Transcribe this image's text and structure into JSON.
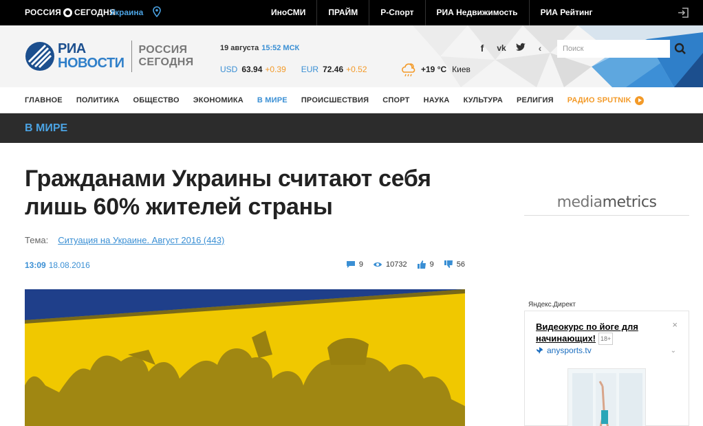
{
  "topbar": {
    "brand_left": "РОССИЯ",
    "brand_right": "СЕГОДНЯ",
    "region": "Украина",
    "links": [
      "ИноСМИ",
      "ПРАЙМ",
      "Р-Спорт",
      "РИА Недвижимость",
      "РИА Рейтинг"
    ]
  },
  "header": {
    "logo_line1": "РИА",
    "logo_line2": "НОВОСТИ",
    "logo_rs1": "РОССИЯ",
    "logo_rs2": "СЕГОДНЯ",
    "date": "19 августа",
    "time": "15:52 МСК",
    "rates": [
      {
        "currency": "USD",
        "value": "63.94",
        "change": "+0.39"
      },
      {
        "currency": "EUR",
        "value": "72.46",
        "change": "+0.52"
      }
    ],
    "weather_temp": "+19 °C",
    "weather_city": "Киев",
    "social": [
      "f",
      "vk",
      "twitter",
      "share"
    ],
    "search_placeholder": "Поиск"
  },
  "nav": {
    "items": [
      "ГЛАВНОЕ",
      "ПОЛИТИКА",
      "ОБЩЕСТВО",
      "ЭКОНОМИКА",
      "В МИРЕ",
      "ПРОИСШЕСТВИЯ",
      "СПОРТ",
      "НАУКА",
      "КУЛЬТУРА",
      "РЕЛИГИЯ"
    ],
    "radio": "РАДИО SPUTNIK"
  },
  "section": {
    "title": "В МИРЕ"
  },
  "article": {
    "headline": "Гражданами Украины считают себя лишь 60% жителей страны",
    "theme_label": "Тема:",
    "theme_link": "Ситуация на Украине. Август 2016 (443)",
    "time": "13:09",
    "date": "18.08.2016",
    "stats": {
      "comments": "9",
      "views": "10732",
      "likes": "9",
      "dislikes": "56"
    }
  },
  "sidebar": {
    "mm_light": "media",
    "mm_bold": "metrics",
    "ydirect": "Яндекс.Директ",
    "ad_title": "Видеокурс по йоге для начинающих!",
    "ad_age": "18+",
    "ad_domain": "anysports.tv",
    "ad_close": "×",
    "ad_chevron": "⌄"
  },
  "colors": {
    "accent": "#3a8fd4",
    "orange": "#f39a28",
    "photo_yellow": "#f0c800",
    "photo_blue": "#1f3f8a"
  }
}
